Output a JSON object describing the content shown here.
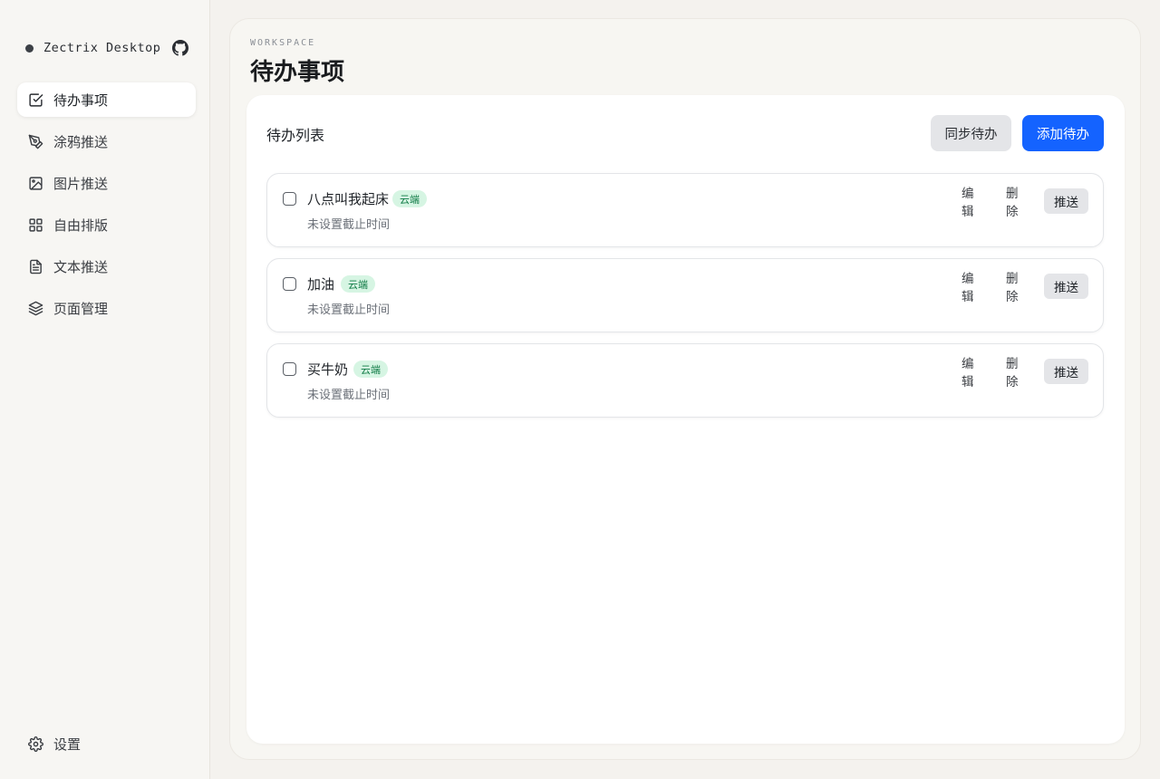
{
  "window": {
    "traffic_lights": [
      "close",
      "minimize",
      "zoom"
    ]
  },
  "sidebar": {
    "brand": "Zectrix Desktop",
    "github_icon": "github-icon",
    "items": [
      {
        "label": "待办事项",
        "icon": "check-square-icon",
        "active": true
      },
      {
        "label": "涂鸦推送",
        "icon": "pen-tool-icon",
        "active": false
      },
      {
        "label": "图片推送",
        "icon": "image-icon",
        "active": false
      },
      {
        "label": "自由排版",
        "icon": "grid-icon",
        "active": false
      },
      {
        "label": "文本推送",
        "icon": "file-text-icon",
        "active": false
      },
      {
        "label": "页面管理",
        "icon": "layers-icon",
        "active": false
      }
    ],
    "settings_label": "设置"
  },
  "main": {
    "eyebrow": "WORKSPACE",
    "title": "待办事项",
    "card": {
      "title": "待办列表",
      "sync_label": "同步待办",
      "add_label": "添加待办"
    },
    "todos": [
      {
        "title": "八点叫我起床",
        "badge": "云端",
        "subtitle": "未设置截止时间",
        "edit": "编辑",
        "delete": "删除",
        "push": "推送"
      },
      {
        "title": "加油",
        "badge": "云端",
        "subtitle": "未设置截止时间",
        "edit": "编辑",
        "delete": "删除",
        "push": "推送"
      },
      {
        "title": "买牛奶",
        "badge": "云端",
        "subtitle": "未设置截止时间",
        "edit": "编辑",
        "delete": "删除",
        "push": "推送"
      }
    ]
  },
  "colors": {
    "accent": "#1463ff",
    "badge_bg": "#d6f5e3",
    "badge_text": "#0f7a45"
  }
}
